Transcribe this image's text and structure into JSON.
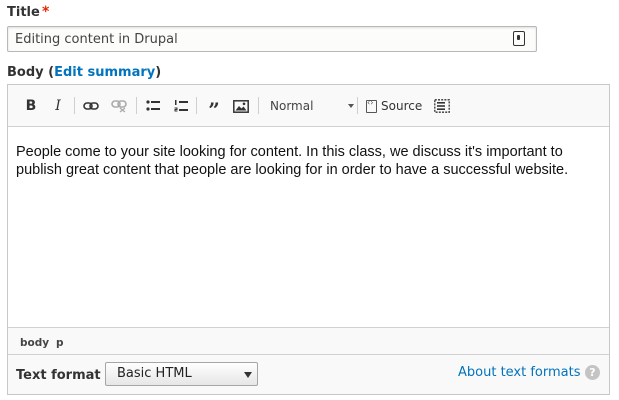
{
  "title_field": {
    "label": "Title",
    "required_mark": "*",
    "value": "Editing content in Drupal",
    "icon": "contact-card-icon"
  },
  "body_field": {
    "label": "Body",
    "open_paren": "(",
    "edit_summary_link": "Edit summary",
    "close_paren": ")"
  },
  "toolbar": {
    "bold_label": "B",
    "italic_label": "I",
    "blockquote_label": "”",
    "format_select_value": "Normal",
    "source_label": "Source",
    "icons": [
      "bold-icon",
      "italic-icon",
      "link-icon",
      "unlink-icon",
      "bulleted-list-icon",
      "numbered-list-icon",
      "blockquote-icon",
      "image-icon",
      "format-dropdown-icon",
      "source-icon",
      "show-blocks-icon"
    ]
  },
  "content": {
    "text": "People come to your site looking for content. In this class, we discuss it's important to publish great content that people are looking for in order to have a successful website."
  },
  "element_path": [
    "body",
    "p"
  ],
  "text_format": {
    "label": "Text format",
    "selected": "Basic HTML",
    "about_link": "About text formats",
    "help_icon_label": "?"
  },
  "colors": {
    "link": "#0074bd",
    "required": "#e62600",
    "toolbar_bg": "#f9f9f9"
  }
}
